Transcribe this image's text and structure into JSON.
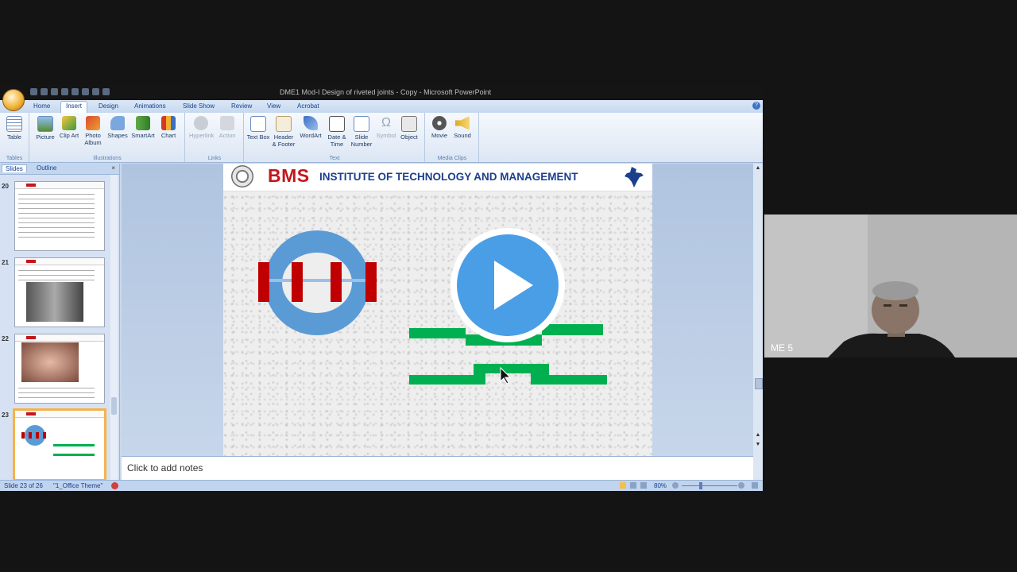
{
  "window": {
    "title": "DME1 Mod-I Design of riveted joints - Copy - Microsoft PowerPoint"
  },
  "tabs": [
    "Home",
    "Insert",
    "Design",
    "Animations",
    "Slide Show",
    "Review",
    "View",
    "Acrobat"
  ],
  "active_tab": "Insert",
  "ribbon": {
    "groups": [
      {
        "label": "Tables",
        "buttons": [
          "Table"
        ]
      },
      {
        "label": "Illustrations",
        "buttons": [
          "Picture",
          "Clip Art",
          "Photo Album",
          "Shapes",
          "SmartArt",
          "Chart"
        ]
      },
      {
        "label": "Links",
        "buttons": [
          "Hyperlink",
          "Action"
        ]
      },
      {
        "label": "Text",
        "buttons": [
          "Text Box",
          "Header & Footer",
          "WordArt",
          "Date & Time",
          "Slide Number",
          "Symbol",
          "Object"
        ]
      },
      {
        "label": "Media Clips",
        "buttons": [
          "Movie",
          "Sound"
        ]
      }
    ]
  },
  "panel": {
    "tabs": [
      "Slides",
      "Outline"
    ],
    "close_glyph": "×",
    "slides": [
      {
        "number": "20"
      },
      {
        "number": "21"
      },
      {
        "number": "22"
      },
      {
        "number": "23",
        "selected": true
      }
    ]
  },
  "slide": {
    "brand": "BMS",
    "institute": "INSTITUTE OF TECHNOLOGY AND MANAGEMENT",
    "play_icon": "play-icon",
    "colors": {
      "blue": "#5b9bd5",
      "red": "#c00000",
      "green": "#00b050",
      "header_blue": "#1c3f8c"
    }
  },
  "notes": {
    "placeholder": "Click to add notes"
  },
  "status": {
    "slide_info": "Slide 23 of 26",
    "theme": "\"1_Office Theme\"",
    "zoom": "80%"
  },
  "webcam": {
    "participant": "ME 5"
  }
}
